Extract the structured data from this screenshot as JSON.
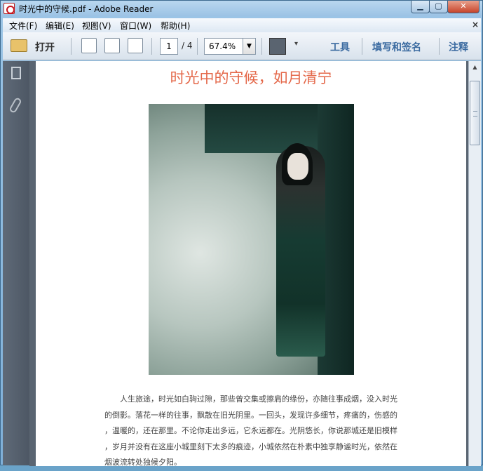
{
  "window": {
    "title": "时光中的守候.pdf - Adobe Reader"
  },
  "menu": [
    "文件(F)",
    "编辑(E)",
    "视图(V)",
    "窗口(W)",
    "帮助(H)"
  ],
  "toolbar": {
    "open_label": "打开",
    "page_current": "1",
    "page_total": "/ 4",
    "zoom": "67.4%",
    "tools_label": "工具",
    "fill_sign_label": "填写和签名",
    "comment_label": "注释"
  },
  "document": {
    "title": "时光中的守候，如月清宁",
    "paragraph_lines": [
      "　　人生旅途，时光如白驹过隙，那些曾交集或擦肩的缘份，亦随往事成烟，没入时光",
      "的倒影。落花一样的往事，飘散在旧光阴里。一回头，发现许多细节，疼痛的，伤感的",
      "，温暖的，还在那里。不论你走出多远，它永远都在。光阴悠长，你说那城还是旧模样",
      "，岁月并没有在这座小城里刻下太多的痕迹，小城依然在朴素中独享静谧时光，依然在",
      "烟波流转处独候夕阳。"
    ]
  },
  "colors": {
    "title": "#e4684a",
    "link_text": "#3a6aa0"
  }
}
